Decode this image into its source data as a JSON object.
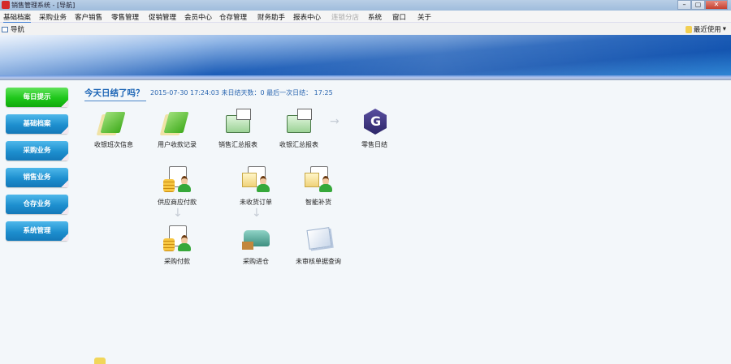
{
  "window": {
    "title": "销售管理系统 - [导航]",
    "controls": [
      "–",
      "▢",
      "✕"
    ]
  },
  "menu": [
    {
      "label": "基础档案",
      "state": "active"
    },
    {
      "label": "采购业务"
    },
    {
      "label": "客户销售"
    },
    {
      "label": "零售管理"
    },
    {
      "label": "促销管理"
    },
    {
      "label": "会员中心"
    },
    {
      "label": "仓存管理"
    },
    {
      "label": "财务助手"
    },
    {
      "label": "报表中心"
    },
    {
      "label": "连锁分店",
      "state": "disabled"
    },
    {
      "label": "系统"
    },
    {
      "label": "窗口"
    },
    {
      "label": "关于"
    }
  ],
  "tab": {
    "label": "导航"
  },
  "recent": {
    "label": "最近使用",
    "caret": "▾"
  },
  "sidebar": [
    {
      "label": "每日提示",
      "active": true
    },
    {
      "label": "基础档案"
    },
    {
      "label": "采购业务"
    },
    {
      "label": "销售业务"
    },
    {
      "label": "仓存业务"
    },
    {
      "label": "系统管理"
    }
  ],
  "main": {
    "heading": "今天日结了吗？",
    "info": "2015-07-30 17:24:03 未日结天数：0 最后一次日结： 17:25",
    "row1": [
      {
        "label": "收银班次信息",
        "icon": "green-book-icon"
      },
      {
        "label": "用户收款记录",
        "icon": "green-book-icon"
      },
      {
        "label": "销售汇总报表",
        "icon": "folder-icon"
      },
      {
        "label": "收银汇总报表",
        "icon": "folder-icon"
      },
      {
        "label": "零售日结",
        "icon": "g-logo-icon"
      }
    ],
    "row2": [
      {
        "label": "供应商应付款",
        "icon": "payment-person-icon"
      },
      {
        "label": "未收货订单",
        "icon": "box-person-icon"
      },
      {
        "label": "智能补货",
        "icon": "box-person-icon"
      }
    ],
    "row3": [
      {
        "label": "采购付款",
        "icon": "payment-person-icon"
      },
      {
        "label": "采购进仓",
        "icon": "truck-icon"
      },
      {
        "label": "未审核单据查询",
        "icon": "documents-icon"
      }
    ],
    "arrows": {
      "right": "→",
      "down": "↓"
    }
  }
}
